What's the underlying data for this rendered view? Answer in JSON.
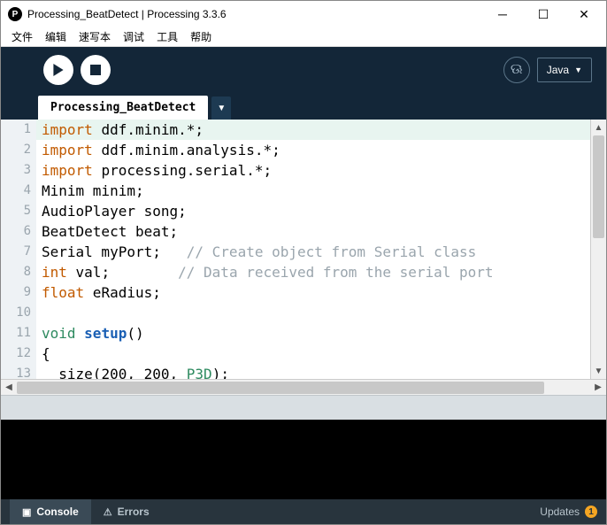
{
  "window": {
    "title": "Processing_BeatDetect | Processing 3.3.6",
    "app_icon_letter": "P"
  },
  "menu": {
    "file": "文件",
    "edit": "编辑",
    "sketch": "速写本",
    "debug": "调试",
    "tools": "工具",
    "help": "帮助"
  },
  "toolbar": {
    "mode_label": "Java"
  },
  "tabs": {
    "main": "Processing_BeatDetect",
    "new_symbol": "▼"
  },
  "code": {
    "lines": [
      {
        "n": 1,
        "curr": true,
        "segs": [
          {
            "t": "import ",
            "c": "kw-import"
          },
          {
            "t": "ddf.minim.*;",
            "c": ""
          }
        ]
      },
      {
        "n": 2,
        "segs": [
          {
            "t": "import ",
            "c": "kw-import"
          },
          {
            "t": "ddf.minim.analysis.*;",
            "c": ""
          }
        ]
      },
      {
        "n": 3,
        "segs": [
          {
            "t": "import ",
            "c": "kw-import"
          },
          {
            "t": "processing.serial.*;",
            "c": ""
          }
        ]
      },
      {
        "n": 4,
        "segs": [
          {
            "t": "Minim minim;",
            "c": ""
          }
        ]
      },
      {
        "n": 5,
        "segs": [
          {
            "t": "AudioPlayer song;",
            "c": ""
          }
        ]
      },
      {
        "n": 6,
        "segs": [
          {
            "t": "BeatDetect beat;",
            "c": ""
          }
        ]
      },
      {
        "n": 7,
        "segs": [
          {
            "t": "Serial myPort;   ",
            "c": ""
          },
          {
            "t": "// Create object from Serial class",
            "c": "cmt"
          }
        ]
      },
      {
        "n": 8,
        "segs": [
          {
            "t": "int",
            "c": "kw-type"
          },
          {
            "t": " val;        ",
            "c": ""
          },
          {
            "t": "// Data received from the serial port",
            "c": "cmt"
          }
        ]
      },
      {
        "n": 9,
        "segs": [
          {
            "t": "float",
            "c": "kw-type"
          },
          {
            "t": " eRadius;",
            "c": ""
          }
        ]
      },
      {
        "n": 10,
        "segs": [
          {
            "t": "",
            "c": ""
          }
        ]
      },
      {
        "n": 11,
        "segs": [
          {
            "t": "void",
            "c": "kw-decl"
          },
          {
            "t": " ",
            "c": ""
          },
          {
            "t": "setup",
            "c": "kw-func"
          },
          {
            "t": "()",
            "c": ""
          }
        ]
      },
      {
        "n": 12,
        "segs": [
          {
            "t": "{",
            "c": ""
          }
        ]
      },
      {
        "n": 13,
        "segs": [
          {
            "t": "  size(",
            "c": ""
          },
          {
            "t": "200",
            "c": "num"
          },
          {
            "t": ", ",
            "c": ""
          },
          {
            "t": "200",
            "c": "num"
          },
          {
            "t": ", ",
            "c": ""
          },
          {
            "t": "P3D",
            "c": "kw-const"
          },
          {
            "t": ");",
            "c": ""
          }
        ]
      }
    ]
  },
  "bottom": {
    "console": "Console",
    "errors": "Errors",
    "updates": "Updates",
    "update_count": "1"
  }
}
